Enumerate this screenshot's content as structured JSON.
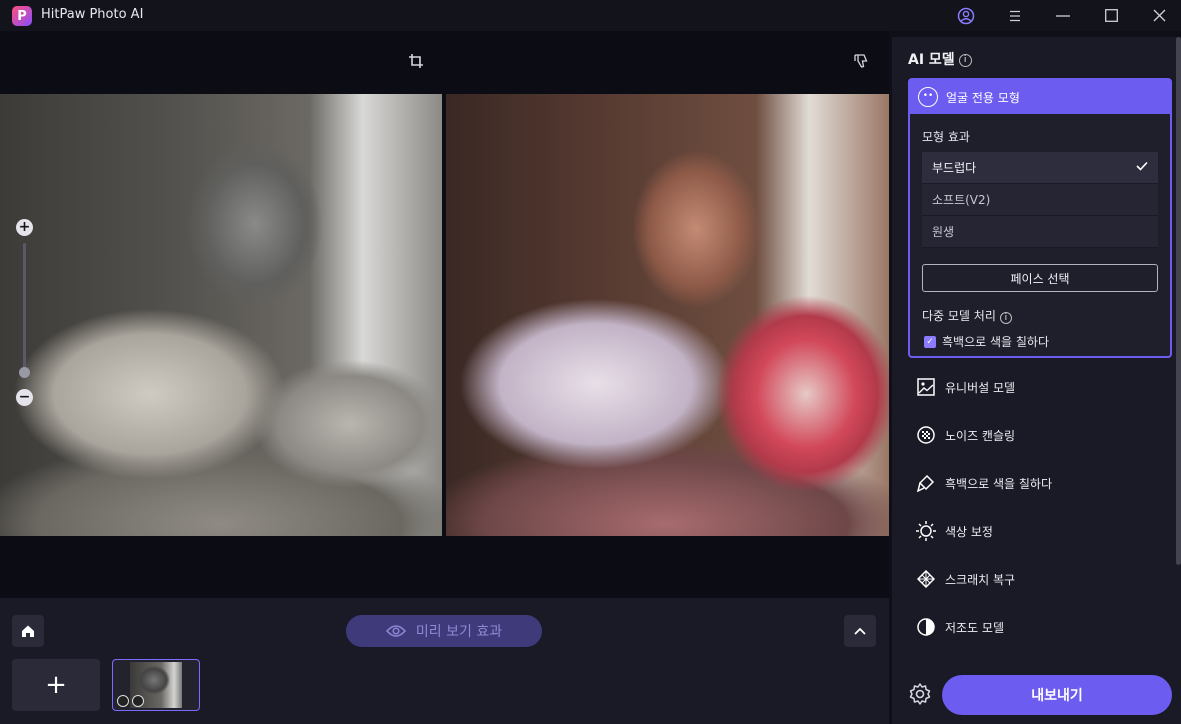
{
  "app": {
    "title": "HitPaw Photo AI",
    "logo_letter": "P"
  },
  "window_controls": [
    "account-icon",
    "menu-icon",
    "minimize-icon",
    "maximize-icon",
    "close-icon"
  ],
  "canvas": {
    "tools": [
      "crop-icon",
      "thumbs-down-icon"
    ],
    "zoom_in": "+",
    "zoom_out": "−"
  },
  "bottom": {
    "preview_label": "미리 보기 효과",
    "add_label": "+"
  },
  "panel": {
    "title": "AI 모델",
    "face_model": {
      "title": "얼굴 전용 모형",
      "effect_label": "모형 효과",
      "options": [
        {
          "label": "부드럽다",
          "selected": true
        },
        {
          "label": "소프트(V2)",
          "selected": false
        },
        {
          "label": "원생",
          "selected": false
        }
      ],
      "face_select_label": "페이스 선택",
      "multi_label": "다중 모델 처리",
      "multi_option_label": "흑백으로 색을 칠하다",
      "multi_option_checked": true
    },
    "models": [
      {
        "label": "유니버설 모델",
        "icon": "image-icon"
      },
      {
        "label": "노이즈 캔슬링",
        "icon": "noise-icon"
      },
      {
        "label": "흑백으로 색을 칠하다",
        "icon": "brush-icon"
      },
      {
        "label": "색상 보정",
        "icon": "sun-icon"
      },
      {
        "label": "스크래치 복구",
        "icon": "scratch-icon"
      },
      {
        "label": "저조도 모델",
        "icon": "contrast-icon"
      }
    ],
    "export_label": "내보내기"
  },
  "colors": {
    "accent": "#6d5cf0",
    "background": "#0f0f17",
    "panel": "#1a1a26"
  }
}
